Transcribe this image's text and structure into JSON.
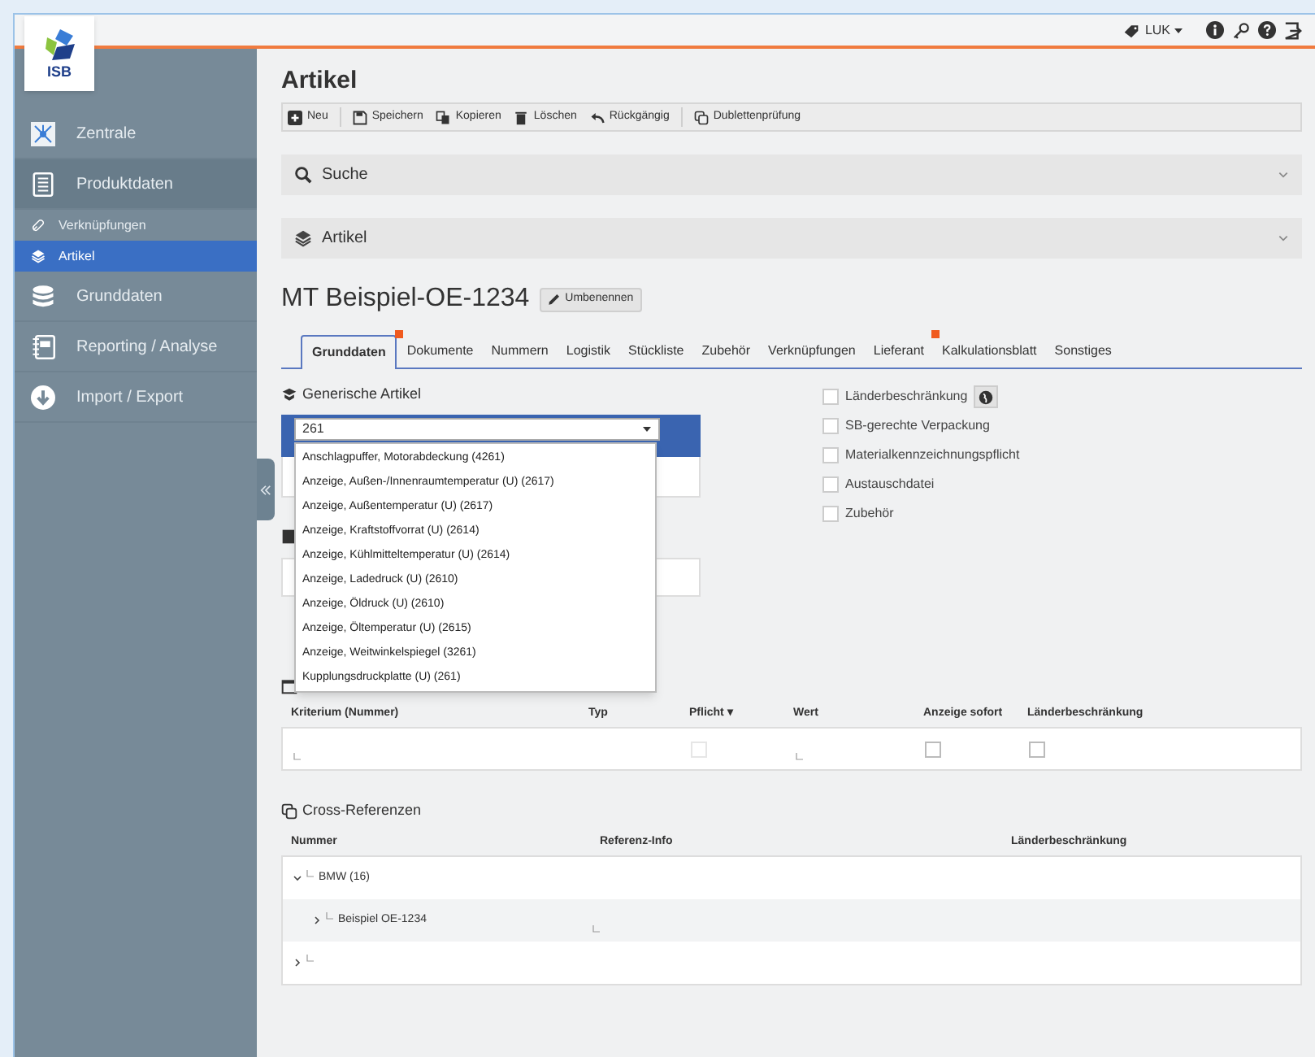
{
  "logo": {
    "text": "ISB"
  },
  "top_bar": {
    "user": "LUK"
  },
  "sidebar": {
    "items": [
      {
        "label": "Zentrale",
        "selected": false
      },
      {
        "label": "Produktdaten",
        "selected": false,
        "expanded": true,
        "children": [
          {
            "label": "Verknüpfungen",
            "selected": false
          },
          {
            "label": "Artikel",
            "selected": true
          }
        ]
      },
      {
        "label": "Grunddaten",
        "selected": false
      },
      {
        "label": "Reporting / Analyse",
        "selected": false
      },
      {
        "label": "Import / Export",
        "selected": false
      }
    ]
  },
  "page_title": "Artikel",
  "toolbar": {
    "groups": [
      [
        "Neu"
      ],
      [
        "Speichern",
        "Kopieren",
        "Löschen",
        "Rückgängig"
      ],
      [
        "Dublettenprüfung"
      ]
    ]
  },
  "panels": [
    {
      "label": "Suche",
      "expanded": false
    },
    {
      "label": "Artikel",
      "expanded": false
    }
  ],
  "article": {
    "name": "MT Beispiel-OE-1234",
    "rename_button": "Umbenennen"
  },
  "tabs": [
    {
      "label": "Grunddaten",
      "selected": true,
      "flag": false
    },
    {
      "label": "Dokumente",
      "selected": false,
      "flag": true
    },
    {
      "label": "Nummern",
      "selected": false,
      "flag": false
    },
    {
      "label": "Logistik",
      "selected": false,
      "flag": false
    },
    {
      "label": "Stückliste",
      "selected": false,
      "flag": false
    },
    {
      "label": "Zubehör",
      "selected": false,
      "flag": false
    },
    {
      "label": "Verknüpfungen",
      "selected": false,
      "flag": false
    },
    {
      "label": "Lieferant",
      "selected": false,
      "flag": false
    },
    {
      "label": "Kalkulationsblatt",
      "selected": false,
      "flag": true
    },
    {
      "label": "Sonstiges",
      "selected": false,
      "flag": false
    }
  ],
  "generic_articles": {
    "heading": "Generische Artikel",
    "value": "261",
    "options": [
      "Anschlagpuffer, Motorabdeckung (4261)",
      "Anzeige, Außen-/Innenraumtemperatur (U) (2617)",
      "Anzeige, Außentemperatur (U) (2617)",
      "Anzeige, Kraftstoffvorrat (U) (2614)",
      "Anzeige, Kühlmitteltemperatur (U) (2614)",
      "Anzeige, Ladedruck (U) (2610)",
      "Anzeige, Öldruck (U) (2610)",
      "Anzeige, Öltemperatur (U) (2615)",
      "Anzeige, Weitwinkelspiegel (3261)",
      "Kupplungsdruckplatte (U) (261)"
    ]
  },
  "checkboxes": [
    {
      "label": "Länderbeschränkung",
      "checked": false,
      "globe_button": true
    },
    {
      "label": "SB-gerechte Verpackung",
      "checked": false,
      "globe_button": false
    },
    {
      "label": "Materialkennzeichnungspflicht",
      "checked": false,
      "globe_button": false
    },
    {
      "label": "Austauschdatei",
      "checked": false,
      "globe_button": false
    },
    {
      "label": "Zubehör",
      "checked": false,
      "globe_button": false
    }
  ],
  "criteria_table": {
    "columns": [
      "Kriterium (Nummer)",
      "Typ",
      "Pflicht ▾",
      "Wert",
      "Anzeige sofort",
      "Länderbeschränkung"
    ],
    "row": {
      "pflicht": {
        "checked": false,
        "disabled": true
      },
      "anzeige_sofort": {
        "checked": false
      },
      "laenderbeschraenkung": {
        "checked": false
      }
    }
  },
  "cross_references": {
    "heading": "Cross-Referenzen",
    "columns": [
      "Nummer",
      "Referenz-Info",
      "Länderbeschränkung"
    ],
    "rows": [
      {
        "label": "BMW (16)",
        "expanded": true,
        "children": [
          {
            "label": "Beispiel OE-1234",
            "expanded": false
          }
        ]
      },
      {
        "expanded": false
      }
    ]
  }
}
